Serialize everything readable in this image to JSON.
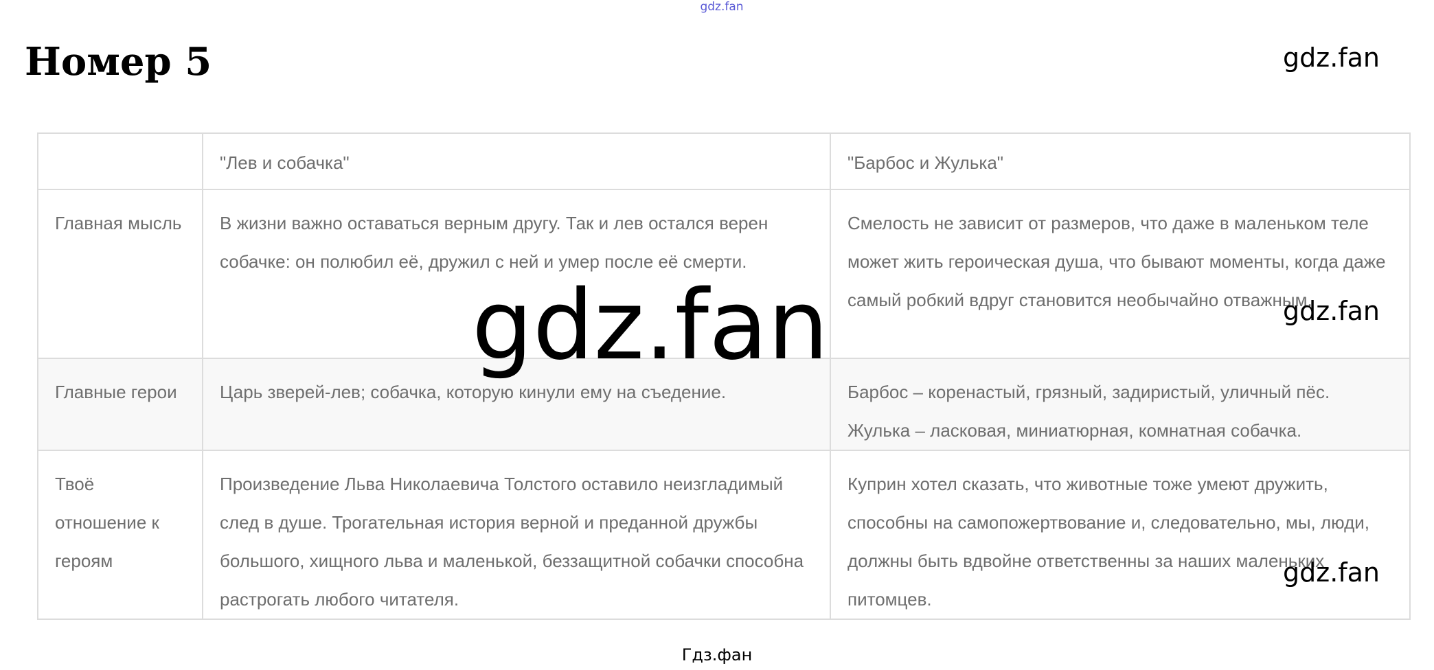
{
  "header": {
    "top_mark": "gdz.fan",
    "title": "Номер 5"
  },
  "watermarks": {
    "small": "gdz.fan",
    "big": "gdz.fan"
  },
  "table": {
    "columns": [
      "",
      "\"Лев и собачка\"",
      "\"Барбос и Жулька\""
    ],
    "rows": [
      {
        "label": "Главная мысль",
        "col1": "В жизни важно оставаться верным другу. Так и лев остался верен собачке: он полюбил её, дружил с ней и умер после её смерти.",
        "col2": "Смелость не зависит от размеров, что даже в маленьком теле может жить героическая душа, что бывают моменты, когда даже самый робкий вдруг становится необычайно отважным."
      },
      {
        "label": "Главные герои",
        "col1": "Царь зверей-лев; собачка, которую кинули ему на съедение.",
        "col2": "Барбос – коренастый, грязный, задиристый, уличный пёс. Жулька – ласковая, миниатюрная, комнатная собачка."
      },
      {
        "label": "Твоё отношение к героям",
        "col1": "Произведение Льва Николаевича Толстого оставило неизгладимый след в душе. Трогательная история верной и преданной дружбы большого, хищного льва и маленькой, беззащитной собачки способна растрогать любого читателя.",
        "col2": "Куприн хотел сказать, что животные тоже умеют дружить, способны на самопожертвование и, следовательно, мы, люди, должны быть вдвойне ответственны за наших маленьких питомцев."
      }
    ]
  },
  "footer": {
    "caption": "Гдз.фан"
  }
}
